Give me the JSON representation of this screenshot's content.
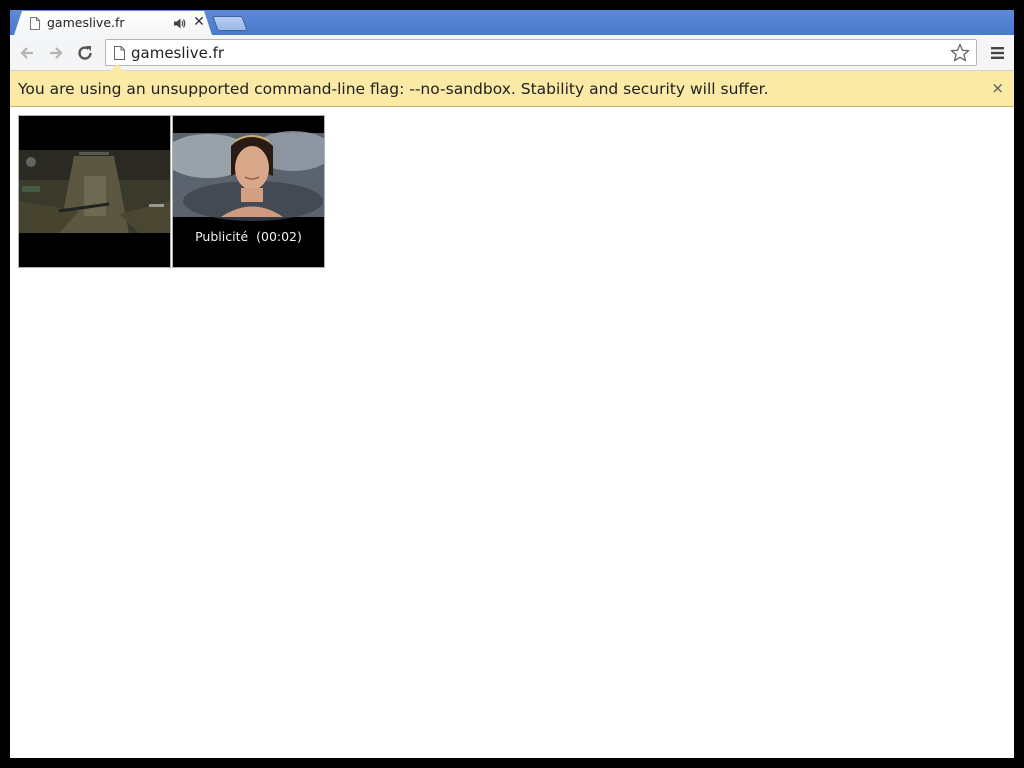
{
  "tab": {
    "title": "gameslive.fr",
    "favicon": "page-icon",
    "audio_icon": "speaker-icon",
    "close_symbol": "✕"
  },
  "toolbar": {
    "back_icon": "back-arrow-icon",
    "forward_icon": "forward-arrow-icon",
    "reload_icon": "reload-icon",
    "url": "gameslive.fr",
    "bookmark_icon": "star-icon",
    "menu_icon": "hamburger-menu-icon"
  },
  "infobar": {
    "message": "You are using an unsupported command-line flag: --no-sandbox. Stability and security will suffer.",
    "close_symbol": "×"
  },
  "content": {
    "ad_caption": "Publicité  (00:02)"
  },
  "colors": {
    "tabstrip": "#4a78cb",
    "infobar": "#fbe9a6"
  }
}
